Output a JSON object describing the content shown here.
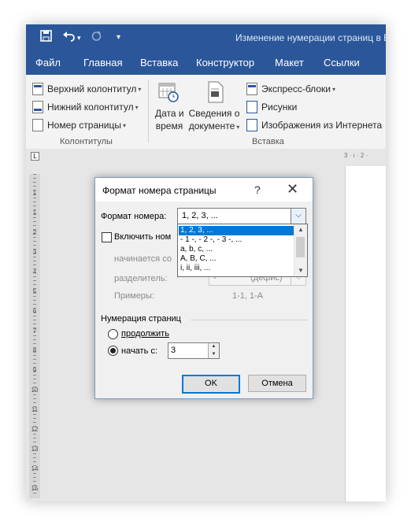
{
  "window": {
    "title": "Изменение нумерации страниц в В",
    "quick_access": {
      "save_icon": "save-icon",
      "undo_icon": "undo-icon",
      "redo_icon": "redo-icon",
      "customize_icon": "customize-icon"
    }
  },
  "ribbon": {
    "tabs": [
      "Файл",
      "Главная",
      "Вставка",
      "Конструктор",
      "Макет",
      "Ссылки"
    ],
    "headers_group": {
      "label": "Колонтитулы",
      "items": [
        "Верхний колонтитул",
        "Нижний колонтитул",
        "Номер страницы"
      ]
    },
    "insert_group": {
      "label": "Вставка",
      "datetime_line1": "Дата и",
      "datetime_line2": "время",
      "docinfo_line1": "Сведения о",
      "docinfo_line2": "документе",
      "quick_parts": "Экспресс-блоки",
      "pictures": "Рисунки",
      "online_pictures": "Изображения из Интернета"
    }
  },
  "ruler": {
    "top_marks": "3 · ı · 2 ·",
    "vertical_numbers": [
      "1",
      "1",
      "2",
      "3",
      "4",
      "5",
      "6",
      "7",
      "8",
      "9",
      "10",
      "11",
      "12",
      "13",
      "14",
      "15"
    ]
  },
  "dialog": {
    "title": "Формат номера страницы",
    "help": "?",
    "close": "✕",
    "number_format_label": "Формат номера:",
    "number_format_value": "1, 2, 3, ...",
    "format_options": [
      "1, 2, 3, ...",
      "- 1 -, - 2 -, - 3 -, ...",
      "a, b, c, ...",
      "A, B, C, ...",
      "i, ii, iii, ..."
    ],
    "include_chapter_label": "Включить ном",
    "chapter_starts_label": "начинается со",
    "separator_label": "разделитель:",
    "separator_value": "-",
    "separator_hint": "(дефис)",
    "examples_label": "Примеры:",
    "examples_value": "1-1, 1-A",
    "page_numbering_label": "Нумерация страниц",
    "continue_label": "продолжить",
    "start_at_label": "начать с:",
    "start_at_value": "3",
    "ok": "OK",
    "cancel": "Отмена"
  }
}
